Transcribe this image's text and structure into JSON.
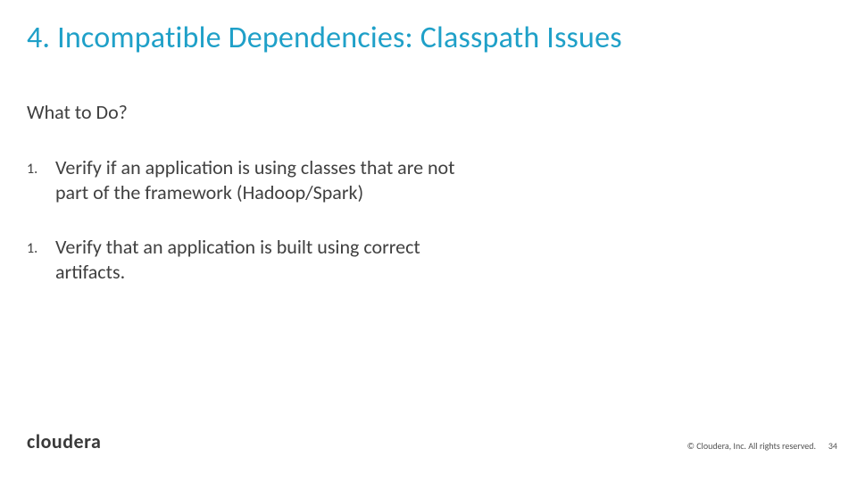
{
  "title": "4. Incompatible Dependencies: Classpath Issues",
  "subhead": "What to Do?",
  "items": [
    {
      "num": "1.",
      "text": "Verify if an application is using classes that are not part of the framework (Hadoop/Spark)"
    },
    {
      "num": "1.",
      "text": "Verify that an application is built using correct artifacts."
    }
  ],
  "logo": "cloudera",
  "copyright": "© Cloudera, Inc. All rights reserved.",
  "pagenum": "34"
}
